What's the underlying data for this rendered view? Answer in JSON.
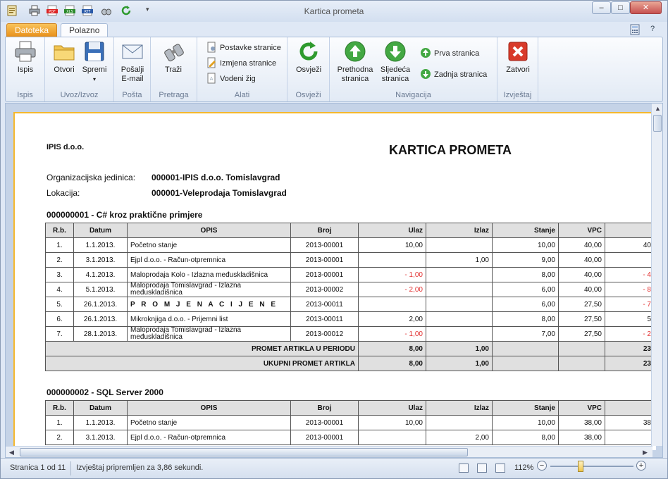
{
  "window": {
    "title": "Kartica prometa"
  },
  "tabs": {
    "file": "Datoteka",
    "home": "Polazno"
  },
  "ribbon": {
    "print": "Ispis",
    "open": "Otvori",
    "save": "Spremi",
    "send": "Pošalji",
    "send2": "E-mail",
    "search": "Traži",
    "page_setup": "Postavke stranice",
    "edit_page": "Izmjena stranice",
    "watermark": "Vodeni žig",
    "refresh": "Osvježi",
    "prev": "Prethodna",
    "prev2": "stranica",
    "next": "Sljedeća",
    "next2": "stranica",
    "first": "Prva stranica",
    "last": "Zadnja stranica",
    "close": "Zatvori",
    "groups": {
      "print": "Ispis",
      "io": "Uvoz/Izvoz",
      "mail": "Pošta",
      "search": "Pretraga",
      "tools": "Alati",
      "refresh": "Osvježi",
      "nav": "Navigacija",
      "report": "Izvještaj"
    }
  },
  "report": {
    "company": "IPIS d.o.o.",
    "title": "KARTICA PROMETA",
    "org_label": "Organizacijska jedinica:",
    "org_value": "000001-IPIS d.o.o. Tomislavgrad",
    "loc_label": "Lokacija:",
    "loc_value": "000001-Veleprodaja Tomislavgrad",
    "headers": [
      "R.b.",
      "Datum",
      "OPIS",
      "Broj",
      "Ulaz",
      "Izlaz",
      "Stanje",
      "VPC"
    ],
    "article1": {
      "title": "000000001 - C# kroz praktične primjere",
      "rows": [
        [
          "1.",
          "1.1.2013.",
          "Početno stanje",
          "2013-00001",
          "10,00",
          "",
          "10,00",
          "40,00",
          "40"
        ],
        [
          "2.",
          "3.1.2013.",
          "Ejpl d.o.o. - Račun-otpremnica",
          "2013-00001",
          "",
          "1,00",
          "9,00",
          "40,00",
          ""
        ],
        [
          "3.",
          "4.1.2013.",
          "Maloprodaja Kolo - Izlazna međuskladišnica",
          "2013-00001",
          "- 1,00",
          "",
          "8,00",
          "40,00",
          "- 4"
        ],
        [
          "4.",
          "5.1.2013.",
          "Maloprodaja Tomislavgrad - Izlazna međuskladišnica",
          "2013-00002",
          "- 2,00",
          "",
          "6,00",
          "40,00",
          "- 8"
        ],
        [
          "5.",
          "26.1.2013.",
          "P R O M J E N A  C I J E N E",
          "2013-00011",
          "",
          "",
          "6,00",
          "27,50",
          "- 7"
        ],
        [
          "6.",
          "26.1.2013.",
          "Mikroknjiga d.o.o. - Prijemni list",
          "2013-00011",
          "2,00",
          "",
          "8,00",
          "27,50",
          "5"
        ],
        [
          "7.",
          "28.1.2013.",
          "Maloprodaja Tomislavgrad - Izlazna međuskladišnica",
          "2013-00012",
          "- 1,00",
          "",
          "7,00",
          "27,50",
          "- 2"
        ]
      ],
      "period_label": "PROMET ARTIKLA U PERIODU",
      "period": [
        "8,00",
        "1,00",
        "23"
      ],
      "total_label": "UKUPNI PROMET ARTIKLA",
      "total": [
        "8,00",
        "1,00",
        "23"
      ]
    },
    "article2": {
      "title": "000000002 - SQL Server 2000",
      "rows": [
        [
          "1.",
          "1.1.2013.",
          "Početno stanje",
          "2013-00001",
          "10,00",
          "",
          "10,00",
          "38,00",
          "38"
        ],
        [
          "2.",
          "3.1.2013.",
          "Ejpl d.o.o. - Račun-otpremnica",
          "2013-00001",
          "",
          "2,00",
          "8,00",
          "38,00",
          ""
        ]
      ]
    }
  },
  "status": {
    "page": "Stranica 1 od 11",
    "time": "Izvještaj pripremljen za 3,86 sekundi.",
    "zoom": "112%",
    "zoom_level": 0.35
  },
  "colors": {
    "accent": "#f5b82e",
    "negative": "#e23030"
  }
}
